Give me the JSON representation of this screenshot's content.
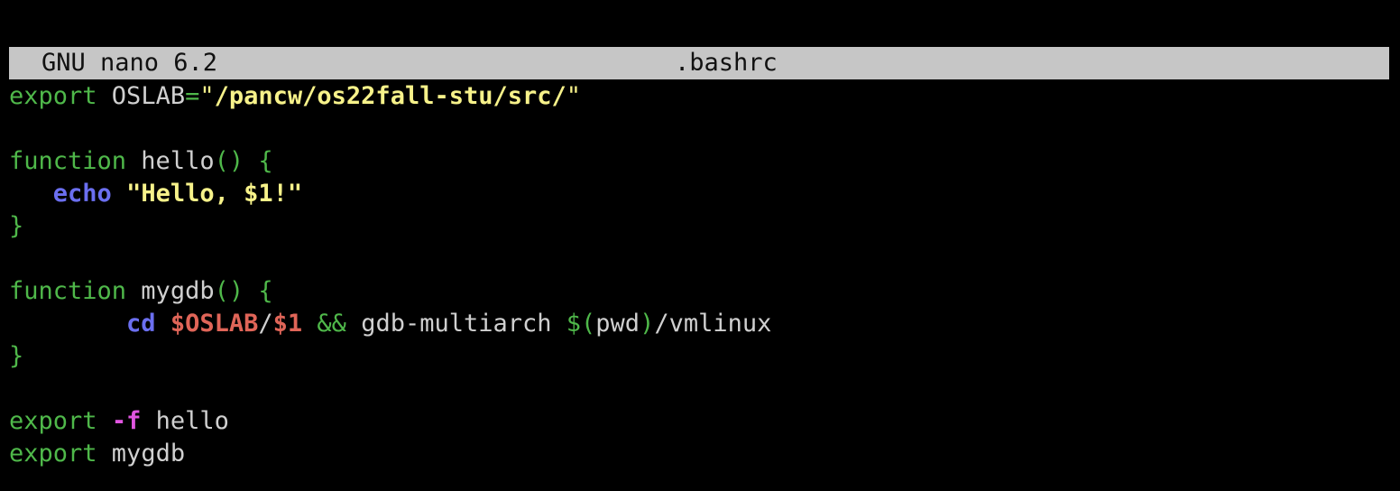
{
  "titlebar": {
    "app": "GNU nano 6.2",
    "filename": ".bashrc"
  },
  "colors": {
    "background": "#000000",
    "titlebar_bg": "#c6c6c6",
    "keyword": "#4fb84a",
    "string": "#f7f28a",
    "builtin": "#6b6ff0",
    "variable": "#e06558",
    "flag": "#e055e0",
    "plain": "#d0d0d0"
  },
  "code": {
    "l1": {
      "kw": "export",
      "name": " OSLAB",
      "eq": "=",
      "q1": "\"",
      "val": "/pancw/os22fall-stu/src/",
      "q2": "\""
    },
    "l3": {
      "kw": "function",
      "name": " hello",
      "parens": "()",
      "brace": " {"
    },
    "l4": {
      "indent": "   ",
      "builtin": "echo",
      "sp": " ",
      "str": "\"Hello, $1!\""
    },
    "l5": {
      "brace": "}"
    },
    "l7": {
      "kw": "function",
      "name": " mygdb",
      "parens": "()",
      "brace": " {"
    },
    "l8": {
      "indent": "        ",
      "builtin": "cd",
      "sp": " ",
      "var1": "$OSLAB",
      "slash": "/",
      "var2": "$1",
      "and": " &&",
      "cmd": " gdb-multiarch ",
      "subst_open": "$(",
      "pwd": "pwd",
      "subst_close": ")",
      "rest": "/vmlinux"
    },
    "l9": {
      "brace": "}"
    },
    "l11": {
      "kw": "export",
      "sp": " ",
      "flag": "-f",
      "name": " hello"
    },
    "l12": {
      "kw": "export",
      "name": " mygdb"
    }
  }
}
